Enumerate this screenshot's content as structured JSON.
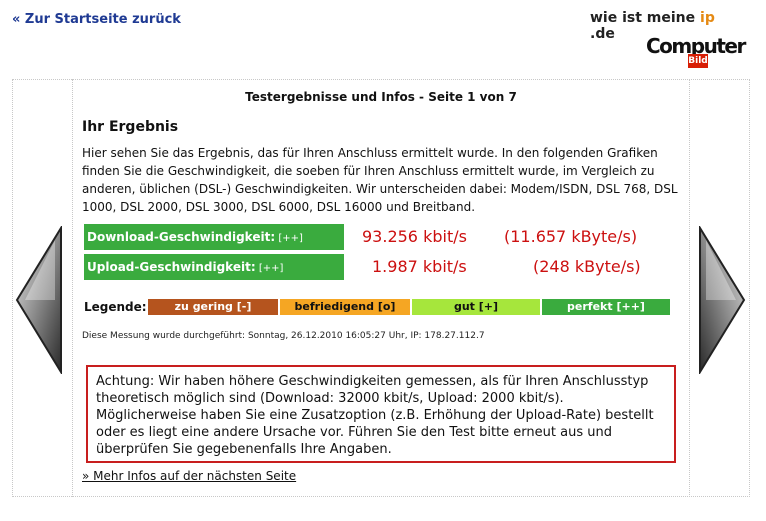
{
  "nav": {
    "back_label": "« Zur Startseite zurück"
  },
  "logo": {
    "part1": "wie ist meine ",
    "part2": "ip",
    "part3": " .de",
    "computer": "Computer",
    "bild": "Bild"
  },
  "header": {
    "page_title": "Testergebnisse und Infos - Seite 1 von 7"
  },
  "result": {
    "title": "Ihr Ergebnis",
    "intro": "Hier sehen Sie das Ergebnis, das für Ihren Anschluss ermittelt wurde. In den folgenden Grafiken finden Sie die Geschwindigkeit, die soeben für Ihren Anschluss ermittelt wurde, im Vergleich zu anderen, üblichen (DSL-) Geschwindigkeiten. Wir unterscheiden dabei: Modem/ISDN, DSL 768, DSL 1000, DSL 2000, DSL 3000, DSL 6000, DSL 16000 und Breitband.",
    "download": {
      "label": "Download-Geschwindigkeit:",
      "tag": " [++]",
      "kbit": "93.256 kbit/s",
      "kbyte": "(11.657 kByte/s)"
    },
    "upload": {
      "label": "Upload-Geschwindigkeit:",
      "tag": " [++]",
      "kbit": "1.987 kbit/s",
      "kbyte": "(248 kByte/s)"
    }
  },
  "legend": {
    "label": "Legende:",
    "items": [
      {
        "text": "zu gering [-]",
        "color": "#b5541e",
        "text_color": "#ffffff"
      },
      {
        "text": "befriedigend [o]",
        "color": "#f5a623",
        "text_color": "#111111"
      },
      {
        "text": "gut [+]",
        "color": "#a6e63c",
        "text_color": "#111111"
      },
      {
        "text": "perfekt [++]",
        "color": "#3aab3e",
        "text_color": "#ffffff"
      }
    ]
  },
  "measurement": {
    "text": "Diese Messung wurde durchgeführt: Sonntag, 26.12.2010 16:05:27 Uhr, IP: 178.27.112.7"
  },
  "warning": {
    "text": "Achtung: Wir haben höhere Geschwindigkeiten gemessen, als für Ihren Anschlusstyp theoretisch möglich sind (Download: 32000 kbit/s, Upload: 2000 kbit/s). Möglicherweise haben Sie eine Zusatzoption (z.B. Erhöhung der Upload-Rate) bestellt oder es liegt eine andere Ursache vor. Führen Sie den Test bitte erneut aus und überprüfen Sie gegebenenfalls Ihre Angaben."
  },
  "footer": {
    "more_link": "» Mehr Infos auf der nächsten Seite"
  },
  "colors": {
    "green": "#3aab3e",
    "red_value": "#cc1010",
    "warning_border": "#c81e1e",
    "link_blue": "#1f3a93"
  }
}
